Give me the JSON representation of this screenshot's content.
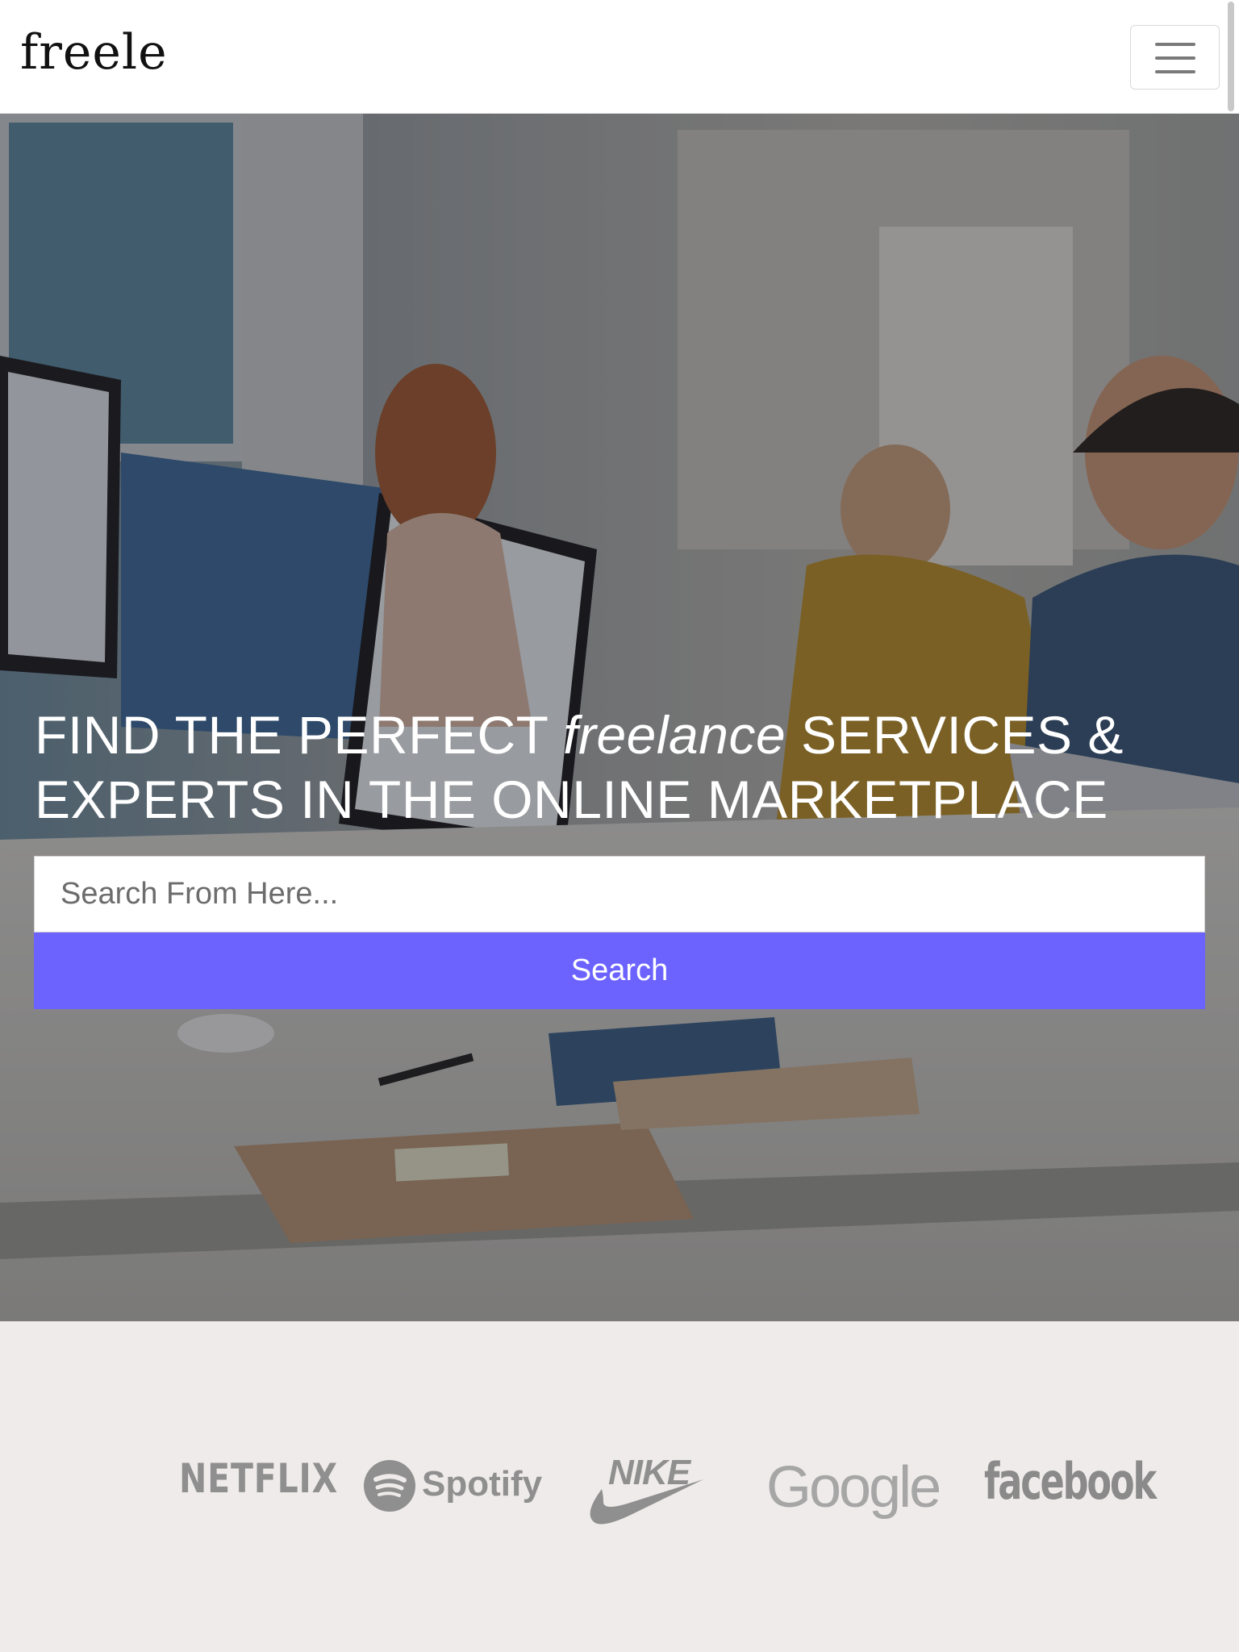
{
  "navbar": {
    "brand": "freele",
    "menu_icon": "hamburger-menu-icon"
  },
  "hero": {
    "headline_part1": "FIND THE PERFECT ",
    "headline_emphasis": "freelance",
    "headline_part2": " SERVICES & EXPERTS IN THE ONLINE MARKETPLACE",
    "search": {
      "placeholder": "Search From Here...",
      "value": ""
    },
    "search_button_label": "Search",
    "accent_color": "#6c63ff",
    "background": "office photo with people working at computers"
  },
  "logos": {
    "items": [
      {
        "name": "netflix-logo",
        "text": "NETFLIX"
      },
      {
        "name": "spotify-logo",
        "text": "Spotify"
      },
      {
        "name": "nike-logo",
        "text": "NIKE"
      },
      {
        "name": "google-logo",
        "text": "Google"
      },
      {
        "name": "facebook-logo",
        "text": "facebook"
      }
    ],
    "color": "#8f8f8f",
    "band_color": "#efebea"
  }
}
